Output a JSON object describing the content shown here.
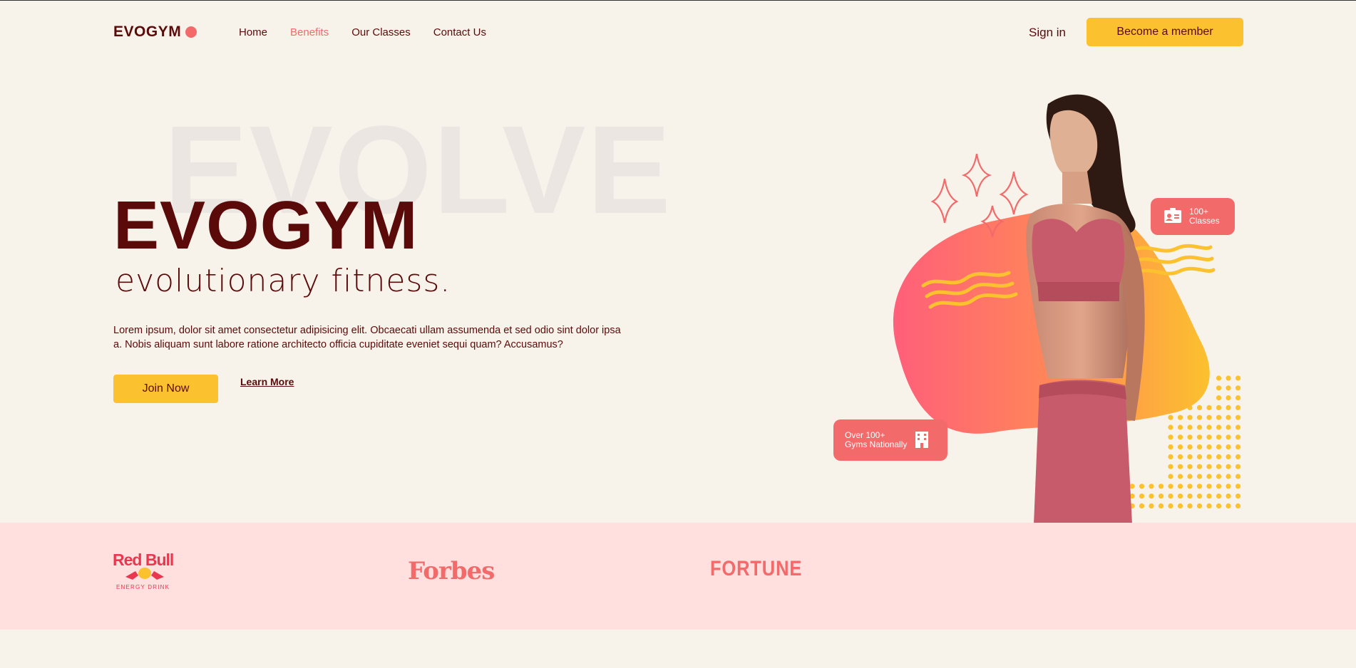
{
  "nav": {
    "logo": "EVOGYM",
    "links": [
      {
        "label": "Home",
        "active": false
      },
      {
        "label": "Benefits",
        "active": true
      },
      {
        "label": "Our Classes",
        "active": false
      },
      {
        "label": "Contact Us",
        "active": false
      }
    ],
    "signin": "Sign in",
    "member_button": "Become a member"
  },
  "hero": {
    "watermark": "EVOLVE",
    "title": "EVOGYM",
    "subtitle": "evolutionary fitness.",
    "description": "Lorem ipsum, dolor sit amet consectetur adipisicing elit. Obcaecati ullam assumenda et sed odio sint dolor ipsa a. Nobis aliquam sunt labore ratione architecto officia cupiditate eveniet sequi quam? Accusamus?",
    "join_button": "Join Now",
    "learn_more": "Learn More"
  },
  "badges": {
    "classes": {
      "line1": "100+",
      "line2": "Classes",
      "icon": "id-card-icon"
    },
    "gyms": {
      "line1": "Over 100+",
      "line2": "Gyms Nationally",
      "icon": "building-icon"
    }
  },
  "sponsors": {
    "redbull": {
      "name": "Red Bull",
      "tagline": "ENERGY DRINK"
    },
    "forbes": "Forbes",
    "fortune": "FORTUNE"
  },
  "colors": {
    "background": "#f8f3ea",
    "primary": "#5b0a0a",
    "accent": "#f26a6a",
    "yellow": "#fcc12e",
    "sponsor_band": "#ffe0df"
  }
}
